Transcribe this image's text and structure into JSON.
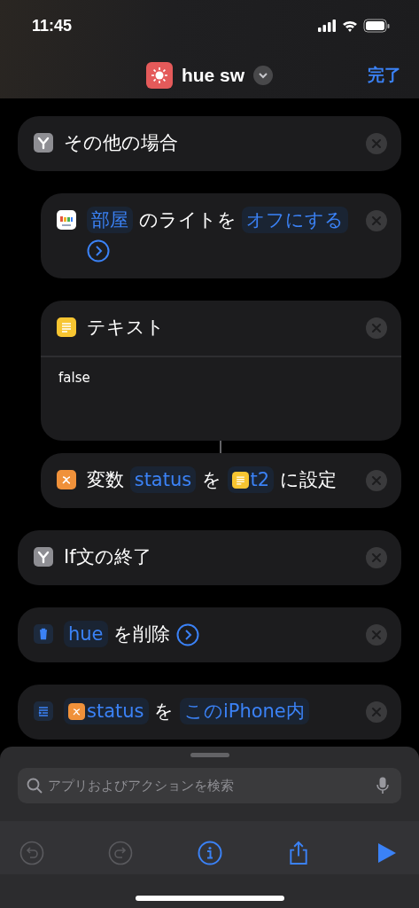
{
  "status_bar": {
    "time": "11:45"
  },
  "header": {
    "title": "hue sw",
    "done": "完了"
  },
  "actions": [
    {
      "kind": "control",
      "tokens": [
        {
          "kind": "text",
          "text": "その他の場合"
        }
      ],
      "children": [
        {
          "kind": "hue",
          "tokens": [
            {
              "kind": "param",
              "text": "部屋"
            },
            {
              "kind": "text",
              "text": "のライトを"
            },
            {
              "kind": "param",
              "text": "オフにする"
            },
            {
              "kind": "arrow"
            }
          ]
        },
        {
          "kind": "text",
          "tokens": [
            {
              "kind": "text",
              "text": "テキスト"
            }
          ],
          "body": "false"
        },
        {
          "kind": "variable",
          "tokens": [
            {
              "kind": "text",
              "text": "変数"
            },
            {
              "kind": "param",
              "text": "status"
            },
            {
              "kind": "text",
              "text": "を"
            },
            {
              "kind": "param-text",
              "text": "t2"
            },
            {
              "kind": "text",
              "text": "に設定"
            }
          ]
        }
      ]
    },
    {
      "kind": "control",
      "tokens": [
        {
          "kind": "text",
          "text": "If文の終了"
        }
      ]
    },
    {
      "kind": "delete",
      "tokens": [
        {
          "kind": "param",
          "text": "hue"
        },
        {
          "kind": "text",
          "text": "を削除"
        },
        {
          "kind": "arrow"
        }
      ]
    },
    {
      "kind": "save",
      "tokens": [
        {
          "kind": "param-variable",
          "text": "status"
        },
        {
          "kind": "text",
          "text": "を"
        },
        {
          "kind": "param",
          "text": "このiPhone内"
        }
      ]
    }
  ],
  "search": {
    "placeholder": "アプリおよびアクションを検索"
  },
  "toolbar": [
    {
      "kind": "undo",
      "disabled": true
    },
    {
      "kind": "redo",
      "disabled": true
    },
    {
      "kind": "info",
      "disabled": false
    },
    {
      "kind": "share",
      "disabled": false
    },
    {
      "kind": "run",
      "disabled": false
    }
  ]
}
